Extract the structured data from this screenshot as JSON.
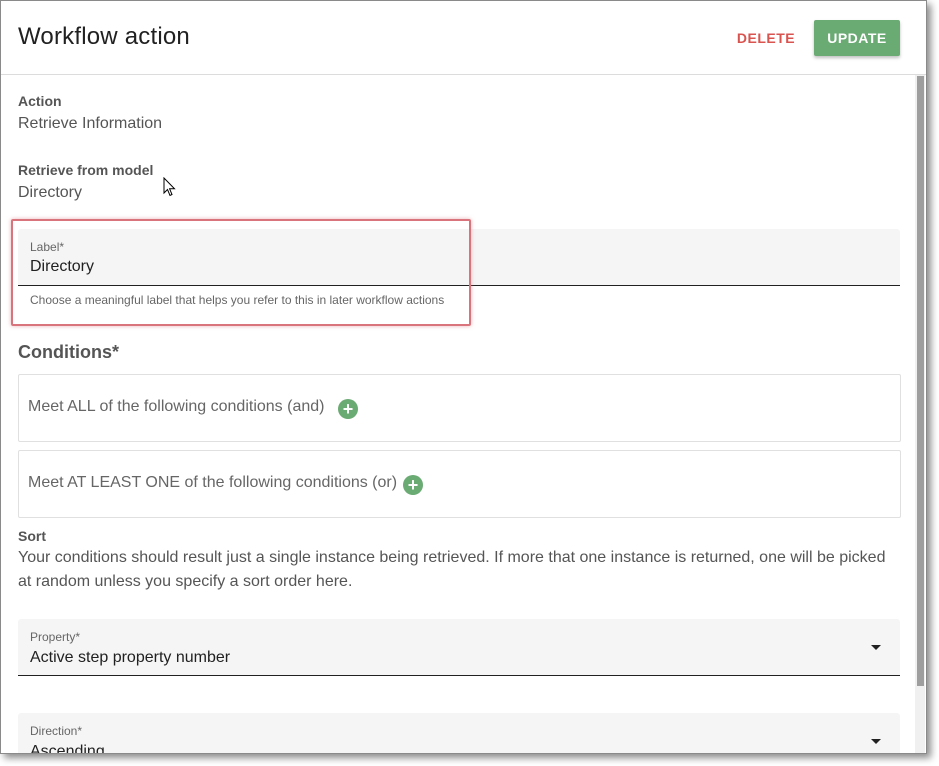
{
  "header": {
    "title": "Workflow action",
    "delete_label": "DELETE",
    "update_label": "UPDATE"
  },
  "action": {
    "label": "Action",
    "value": "Retrieve Information"
  },
  "model": {
    "label": "Retrieve from model",
    "value": "Directory"
  },
  "label_field": {
    "label": "Label*",
    "value": "Directory",
    "helper": "Choose a meaningful label that helps you refer to this in later workflow actions"
  },
  "conditions": {
    "title": "Conditions*",
    "all_text": "Meet ALL of the following conditions (and)",
    "any_text": "Meet AT LEAST ONE of the following conditions (or)"
  },
  "sort": {
    "label": "Sort",
    "description": "Your conditions should result just a single instance being retrieved. If more that one instance is returned, one will be picked at random unless you specify a sort order here."
  },
  "property_field": {
    "label": "Property*",
    "value": "Active step property number"
  },
  "direction_field": {
    "label": "Direction*",
    "value": "Ascending"
  },
  "icons": {
    "plus": "plus-circle-icon",
    "dropdown": "caret-down-icon",
    "cursor": "mouse-cursor-icon"
  },
  "colors": {
    "accent_green": "#6aaa73",
    "delete_red": "#d9534f",
    "highlight_red": "#d9747d"
  }
}
